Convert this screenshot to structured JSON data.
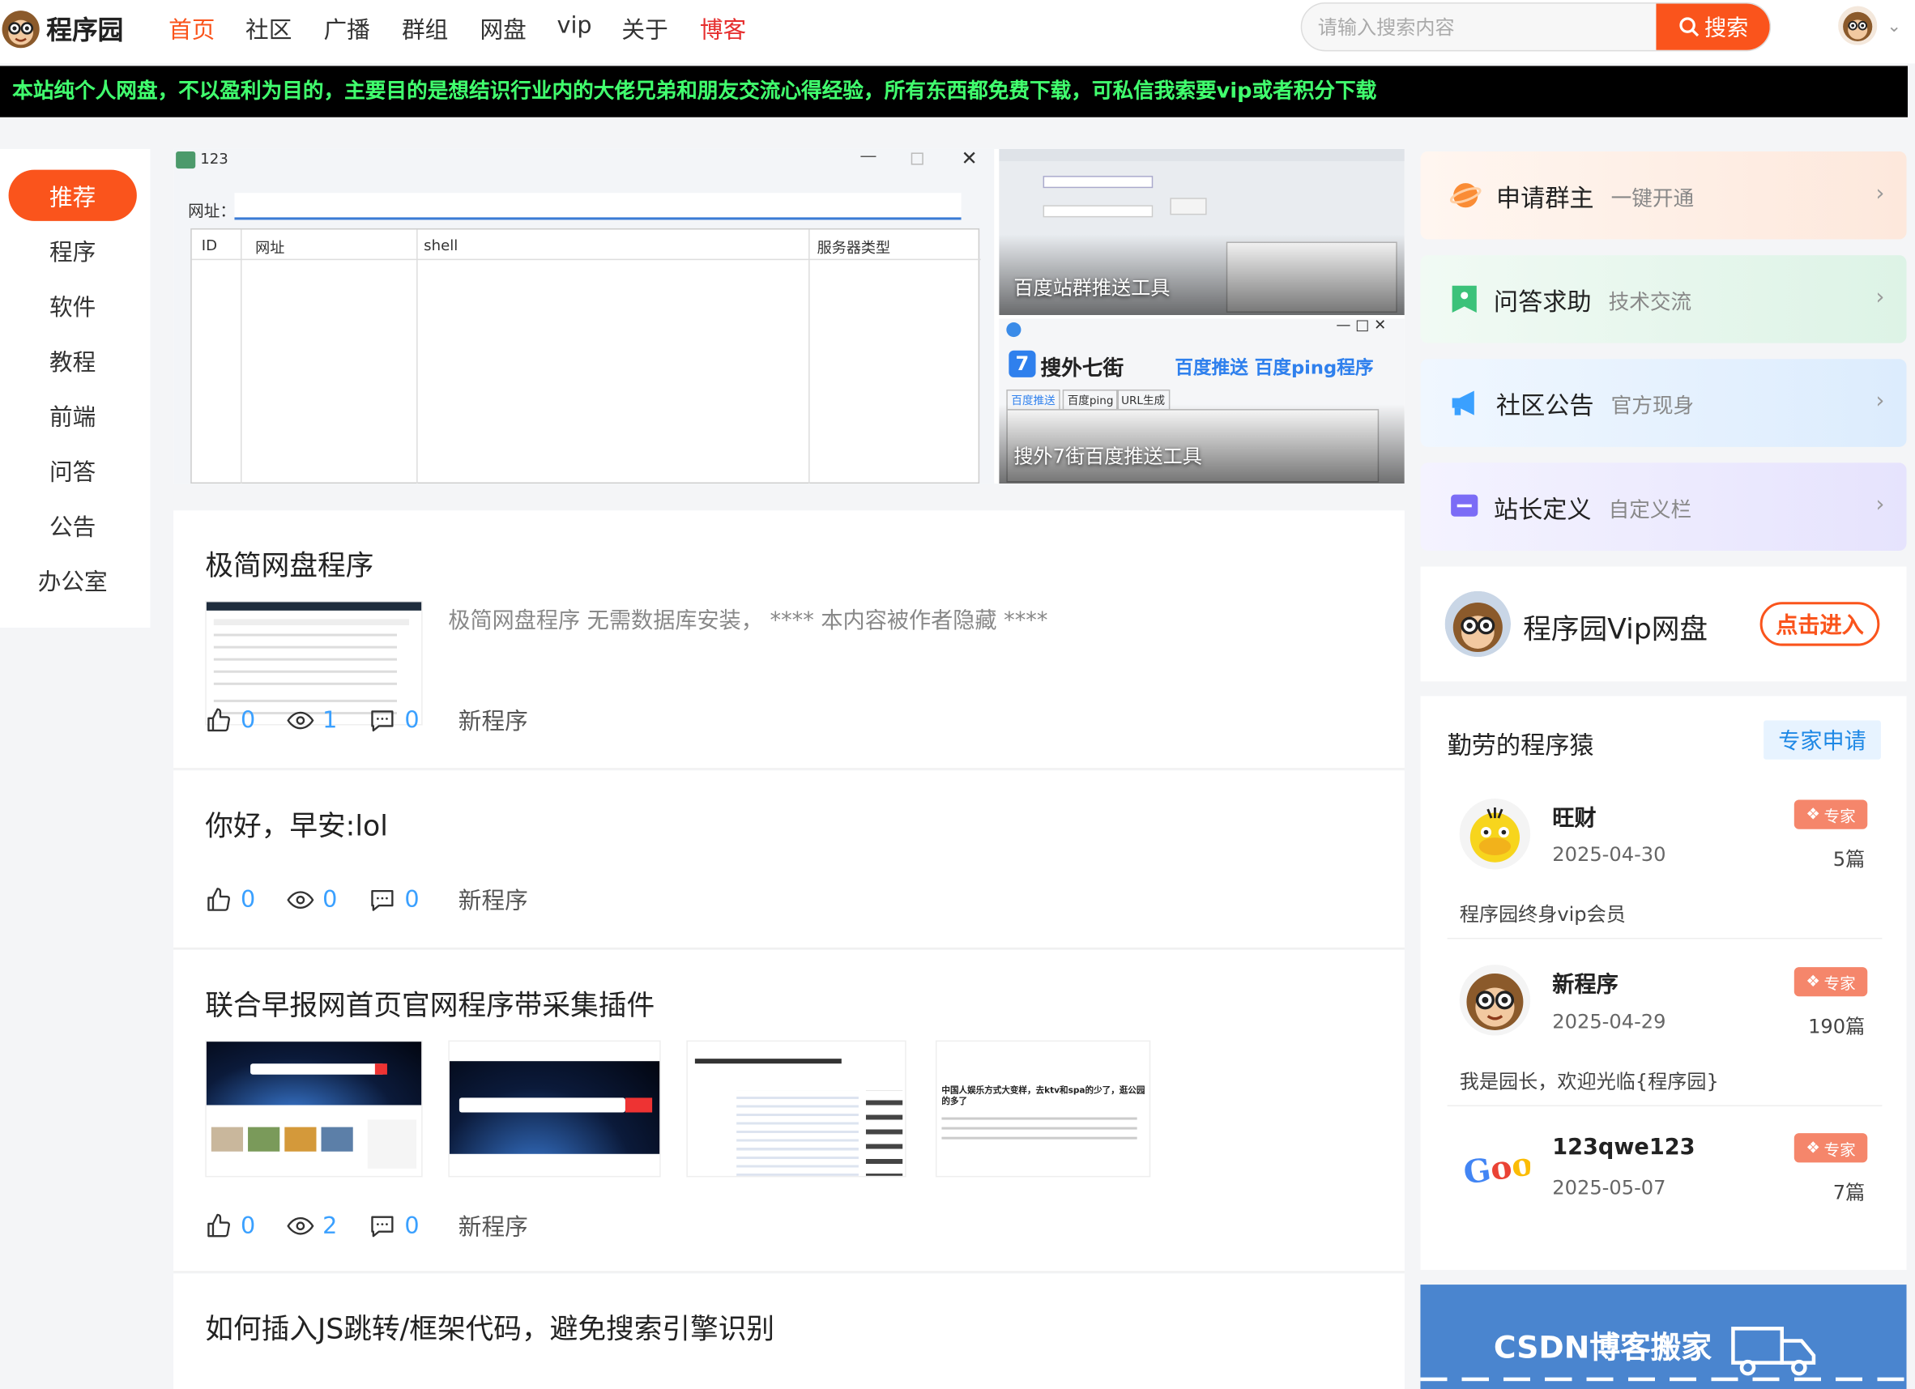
{
  "site": {
    "name": "程序园",
    "icon": "monkey-avatar-icon"
  },
  "nav": [
    {
      "label": "首页",
      "active": true
    },
    {
      "label": "社区"
    },
    {
      "label": "广播"
    },
    {
      "label": "群组"
    },
    {
      "label": "网盘"
    },
    {
      "label": "vip"
    },
    {
      "label": "关于"
    },
    {
      "label": "博客",
      "highlight": true
    }
  ],
  "search": {
    "placeholder": "请输入搜索内容",
    "button": "搜索"
  },
  "notice": "本站纯个人网盘，不以盈利为目的，主要目的是想结识行业内的大佬兄弟和朋友交流心得经验，所有东西都免费下载，可私信我索要vip或者积分下载",
  "categories": [
    "推荐",
    "程序",
    "软件",
    "教程",
    "前端",
    "问答",
    "公告",
    "办公室"
  ],
  "banner": {
    "main": {
      "window_title": "123",
      "url_label": "网址：",
      "columns": [
        "ID",
        "网址",
        "shell",
        "服务器类型"
      ]
    },
    "top_right": {
      "caption": "百度站群推送工具"
    },
    "bottom_right": {
      "caption": "搜外7街百度推送工具",
      "brand": "搜外七街",
      "headline": "百度推送 百度ping程序",
      "tabs": [
        "百度推送",
        "百度ping",
        "URL生成"
      ]
    }
  },
  "posts": [
    {
      "title": "极简网盘程序",
      "excerpt": "极简网盘程序 无需数据库安装，  **** 本内容被作者隐藏 ****",
      "likes": "0",
      "views": "1",
      "comments": "0",
      "author": "新程序"
    },
    {
      "title": "你好，早安:lol",
      "likes": "0",
      "views": "0",
      "comments": "0",
      "author": "新程序"
    },
    {
      "title": "联合早报网首页官网程序带采集插件",
      "likes": "0",
      "views": "2",
      "comments": "0",
      "author": "新程序",
      "thumb_text": "中国人娱乐方式大变样，去ktv和spa的少了，逛公园的多了"
    },
    {
      "title": "如何插入JS跳转/框架代码，避免搜索引擎识别"
    }
  ],
  "side_cards": [
    {
      "title": "申请群主",
      "sub": "一键开通",
      "icon": "planet-icon",
      "color": "#fa8c35"
    },
    {
      "title": "问答求助",
      "sub": "技术交流",
      "icon": "question-icon",
      "color": "#3cc27a"
    },
    {
      "title": "社区公告",
      "sub": "官方现身",
      "icon": "megaphone-icon",
      "color": "#3aa0ff"
    },
    {
      "title": "站长定义",
      "sub": "自定义栏",
      "icon": "chat-icon",
      "color": "#7b6cf6"
    }
  ],
  "vip": {
    "title": "程序园Vip网盘",
    "button": "点击进入"
  },
  "experts": {
    "title": "勤劳的程序猿",
    "apply": "专家申请",
    "badge": "专家",
    "list": [
      {
        "name": "旺财",
        "date": "2025-04-30",
        "count": "5篇",
        "desc": "程序园终身vip会员"
      },
      {
        "name": "新程序",
        "date": "2025-04-29",
        "count": "190篇",
        "desc": "我是园长，欢迎光临{程序园}"
      },
      {
        "name": "123qwe123",
        "date": "2025-05-07",
        "count": "7篇"
      }
    ]
  },
  "csdn": {
    "title": "CSDN博客搬家"
  }
}
